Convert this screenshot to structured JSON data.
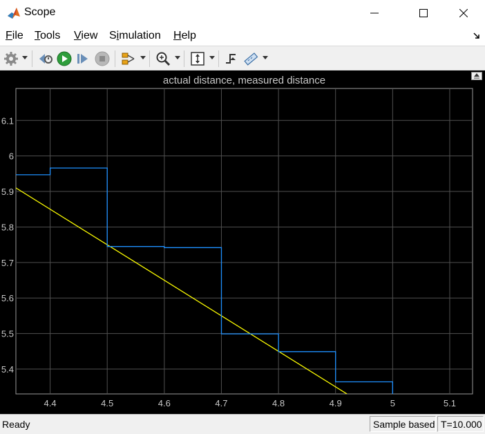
{
  "window": {
    "title": "Scope"
  },
  "menu": {
    "items": [
      {
        "label": "File",
        "mnemonic_index": 0
      },
      {
        "label": "Tools",
        "mnemonic_index": 0
      },
      {
        "label": "View",
        "mnemonic_index": 0
      },
      {
        "label": "Simulation",
        "mnemonic_index": 1
      },
      {
        "label": "Help",
        "mnemonic_index": 0
      }
    ]
  },
  "toolbar": {
    "buttons": [
      "settings-icon",
      "step-back-icon",
      "run-icon",
      "step-forward-icon",
      "stop-icon",
      "signal-selector-icon",
      "zoom-in-icon",
      "scale-axes-icon",
      "triggers-icon",
      "measurements-icon"
    ]
  },
  "status": {
    "ready": "Ready",
    "mode": "Sample based",
    "time": "T=10.000"
  },
  "colors": {
    "actual_line": "#ffff00",
    "measured_line": "#1e90ff",
    "plot_bg": "#000000",
    "grid": "#505050",
    "tick_text": "#c8c8c8"
  },
  "chart_data": {
    "type": "line",
    "title": "actual distance, measured distance",
    "xlabel": "",
    "ylabel": "",
    "xlim": [
      4.34,
      5.14
    ],
    "ylim": [
      5.33,
      6.19
    ],
    "grid": true,
    "x_ticks": [
      4.4,
      4.5,
      4.6,
      4.7,
      4.8,
      4.9,
      5,
      5.1
    ],
    "y_ticks": [
      5.4,
      5.5,
      5.6,
      5.7,
      5.8,
      5.9,
      6,
      6.1
    ],
    "series": [
      {
        "name": "",
        "color": "#ffff00",
        "step": false,
        "x": [
          4.34,
          4.92
        ],
        "y": [
          5.91,
          5.33
        ]
      },
      {
        "name": "",
        "color": "#1e90ff",
        "step": true,
        "x": [
          4.34,
          4.4,
          4.4,
          4.5,
          4.5,
          4.6,
          4.6,
          4.7,
          4.7,
          4.8,
          4.8,
          4.9,
          4.9,
          5.0,
          5.0
        ],
        "y": [
          5.947,
          5.947,
          5.966,
          5.966,
          5.745,
          5.745,
          5.742,
          5.742,
          5.499,
          5.499,
          5.449,
          5.449,
          5.364,
          5.364,
          5.33
        ]
      }
    ]
  }
}
